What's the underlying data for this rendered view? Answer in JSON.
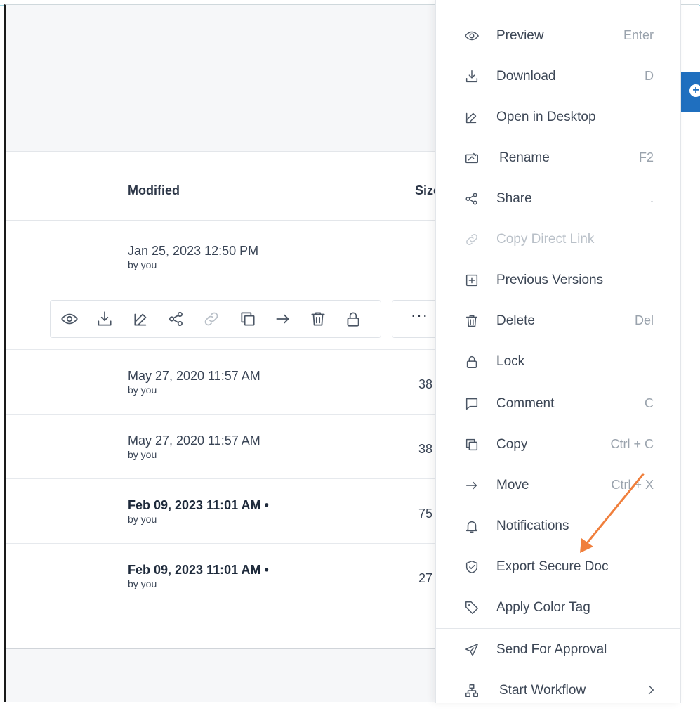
{
  "table": {
    "columns": {
      "modified": "Modified",
      "size": "Size"
    },
    "rows": [
      {
        "date": "Jan 25, 2023 12:50 PM",
        "by": "by you",
        "size": ""
      },
      {
        "date": "May 27, 2020 11:57 AM",
        "by": "by you",
        "size": "38"
      },
      {
        "date": "May 27, 2020 11:57 AM",
        "by": "by you",
        "size": "38"
      },
      {
        "date": "Feb 09, 2023 11:01 AM •",
        "by": "by you",
        "size": "75 |"
      },
      {
        "date": "Feb 09, 2023 11:01 AM •",
        "by": "by you",
        "size": "27 |"
      }
    ]
  },
  "action_bar": {
    "icons": [
      "eye-icon",
      "download-icon",
      "edit-icon",
      "share-icon",
      "link-icon",
      "copy-icon",
      "move-arrow-icon",
      "trash-icon",
      "lock-icon"
    ],
    "more_label": "···"
  },
  "context_menu": {
    "items": [
      {
        "label": "Preview",
        "shortcut": "Enter",
        "icon": "eye-icon"
      },
      {
        "label": "Download",
        "shortcut": "D",
        "icon": "download-icon"
      },
      {
        "label": "Open in Desktop",
        "shortcut": "",
        "icon": "edit-icon"
      },
      {
        "label": "Rename",
        "shortcut": "F2",
        "icon": "rename-icon"
      },
      {
        "label": "Share",
        "shortcut": ".",
        "icon": "share-icon"
      },
      {
        "label": "Copy Direct Link",
        "shortcut": "",
        "icon": "link-icon",
        "disabled": true
      },
      {
        "label": "Previous Versions",
        "shortcut": "",
        "icon": "versions-icon"
      },
      {
        "label": "Delete",
        "shortcut": "Del",
        "icon": "trash-icon"
      },
      {
        "label": "Lock",
        "shortcut": "",
        "icon": "lock-icon"
      },
      {
        "label": "Comment",
        "shortcut": "C",
        "icon": "comment-icon"
      },
      {
        "label": "Copy",
        "shortcut": "Ctrl + C",
        "icon": "copy-icon"
      },
      {
        "label": "Move",
        "shortcut": "Ctrl + X",
        "icon": "move-arrow-icon"
      },
      {
        "label": "Notifications",
        "shortcut": "",
        "icon": "bell-icon"
      },
      {
        "label": "Export Secure Doc",
        "shortcut": "",
        "icon": "shield-icon"
      },
      {
        "label": "Apply Color Tag",
        "shortcut": "",
        "icon": "tag-icon"
      },
      {
        "label": "Send For Approval",
        "shortcut": "",
        "icon": "send-icon"
      },
      {
        "label": "Start Workflow",
        "shortcut": "",
        "icon": "workflow-icon",
        "submenu": true
      }
    ]
  },
  "colors": {
    "accent": "#1f6fbf",
    "annotation_arrow": "#f07f3c"
  }
}
